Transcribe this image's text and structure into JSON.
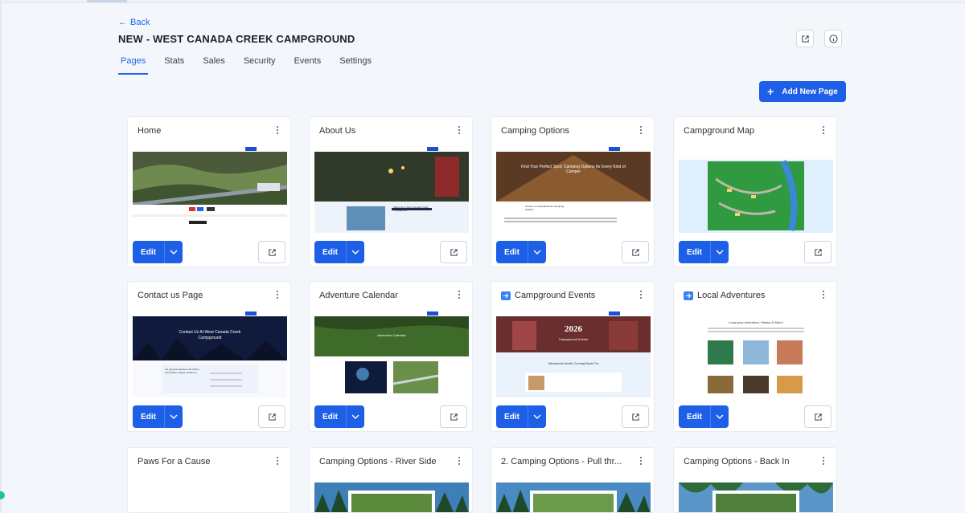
{
  "nav": {
    "back_label": "Back"
  },
  "header": {
    "title": "NEW - WEST CANADA CREEK CAMPGROUND"
  },
  "tabs": [
    {
      "label": "Pages",
      "active": true
    },
    {
      "label": "Stats",
      "active": false
    },
    {
      "label": "Sales",
      "active": false
    },
    {
      "label": "Security",
      "active": false
    },
    {
      "label": "Events",
      "active": false
    },
    {
      "label": "Settings",
      "active": false
    }
  ],
  "actions": {
    "add_page_label": "Add New Page"
  },
  "buttons": {
    "edit_label": "Edit"
  },
  "pages": [
    {
      "title": "Home"
    },
    {
      "title": "About Us"
    },
    {
      "title": "Camping Options"
    },
    {
      "title": "Campground Map"
    },
    {
      "title": "Contact us Page"
    },
    {
      "title": "Adventure Calendar"
    },
    {
      "title": "Campground Events"
    },
    {
      "title": "Local Adventures"
    },
    {
      "title": "Paws For a Cause"
    },
    {
      "title": "Camping Options - River Side"
    },
    {
      "title": "2. Camping Options - Pull thr..."
    },
    {
      "title": "Camping Options - Back In"
    }
  ],
  "thumbs": {
    "about_heading": "Welcome to West Canada Creek Campground",
    "camping_heading": "Find Your Perfect Spot: Camping Options for Every Kind of Camper",
    "camping_sub": "Choose a Lovely Boat Our Camping Options",
    "contact_heading": "Contact Us At West Canada Creek Campground",
    "contact_sub": "For general inquiries and further information, please contact us",
    "calendar_heading": "Adventure Calendar",
    "events_year": "2026",
    "events_heading": "Campground Events",
    "events_sub": "Weekends Worth Coming Back For",
    "local_heading": "Local your Adventure, History & More!"
  },
  "colors": {
    "accent": "#1d5fe6",
    "tab_active": "#2563eb",
    "background": "#f3f7fb"
  }
}
